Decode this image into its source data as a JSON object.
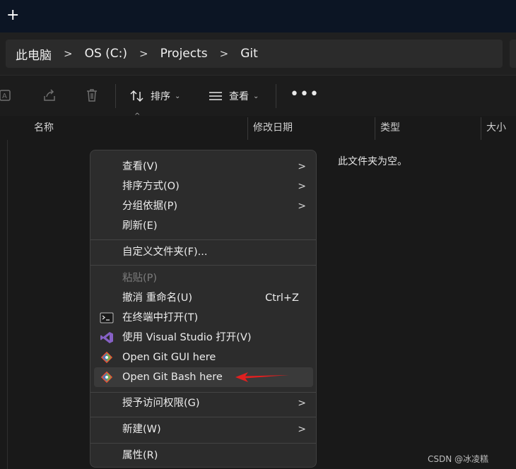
{
  "window": {
    "new_tab_symbol": "+"
  },
  "breadcrumb": [
    "此电脑",
    "OS (C:)",
    "Projects",
    "Git"
  ],
  "toolbar": {
    "sort_label": "排序",
    "view_label": "查看",
    "more_label": "•••"
  },
  "columns": {
    "name": "名称",
    "modified": "修改日期",
    "type": "类型",
    "size": "大小"
  },
  "folder": {
    "empty_message": "此文件夹为空。"
  },
  "context_menu": {
    "view": "查看(V)",
    "sort_by": "排序方式(O)",
    "group_by": "分组依据(P)",
    "refresh": "刷新(E)",
    "customize_folder": "自定义文件夹(F)...",
    "paste": "粘贴(P)",
    "undo_rename": "撤消 重命名(U)",
    "undo_shortcut": "Ctrl+Z",
    "open_terminal": "在终端中打开(T)",
    "open_visual_studio": "使用 Visual Studio 打开(V)",
    "open_git_gui": "Open Git GUI here",
    "open_git_bash": "Open Git Bash here",
    "give_access": "授予访问权限(G)",
    "new": "新建(W)",
    "properties": "属性(R)"
  },
  "watermark": "CSDN @冰凌糕",
  "colors": {
    "accent_arrow": "#e02020",
    "git_orange": "#f05033",
    "vs_purple": "#8661c5"
  }
}
